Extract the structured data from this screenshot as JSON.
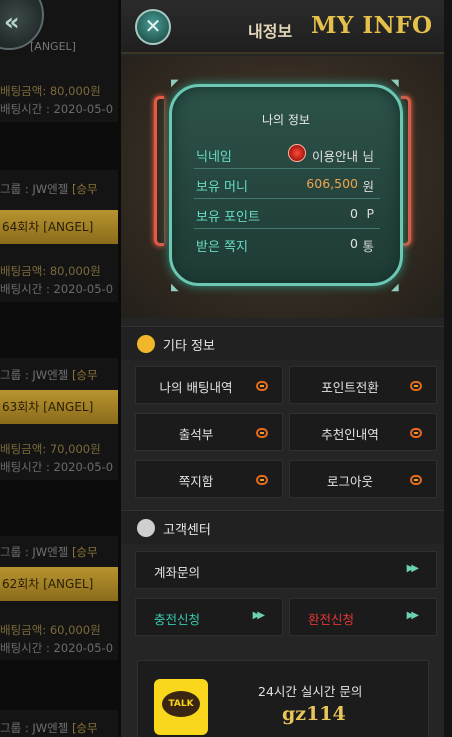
{
  "background_list": {
    "top_text": "[ANGEL]",
    "items": [
      {
        "amount": "배팅금액: 80,000원",
        "time": "배팅시간 : 2020-05-0",
        "team": "그룹 : JW엔젤 ",
        "status": "[승무"
      },
      {
        "round": "64회차 [ANGEL]",
        "amount": "배팅금액: 80,000원",
        "time": "배팅시간 : 2020-05-0",
        "team": "그룹 : JW엔젤 ",
        "status": "[승무"
      },
      {
        "round": "63회차 [ANGEL]",
        "amount": "배팅금액: 70,000원",
        "time": "배팅시간 : 2020-05-0",
        "team": "그룹 : JW엔젤 ",
        "status": "[승무"
      },
      {
        "round": "62회차 [ANGEL]",
        "amount": "배팅금액: 60,000원",
        "time": "배팅시간 : 2020-05-0",
        "team": "그룹 : JW엔젤 ",
        "status": "[승무"
      }
    ]
  },
  "header": {
    "close_icon": "close-x-icon",
    "title_kr": "내정보",
    "title_en": "MY INFO"
  },
  "info": {
    "title": "나의 정보",
    "nickname_label": "닉네임",
    "nickname_value": "이용안내",
    "nickname_suffix": "님",
    "money_label": "보유 머니",
    "money_value": "606,500",
    "money_unit": "원",
    "point_label": "보유 포인트",
    "point_value": "0",
    "point_unit": "P",
    "message_label": "받은 쪽지",
    "message_value": "0",
    "message_unit": "통"
  },
  "etc": {
    "title": "기타 정보",
    "buttons": [
      "나의 배팅내역",
      "포인트전환",
      "출석부",
      "추천인내역",
      "쪽지함",
      "로그아웃"
    ]
  },
  "support": {
    "title": "고객센터",
    "account_inquiry": "계좌문의",
    "charge": "충전신청",
    "exchange": "환전신청",
    "arrow": "▶▶"
  },
  "kakao": {
    "logo_text": "TALK",
    "line1": "24시간 실시간 문의",
    "line2": "gz114"
  },
  "colors": {
    "accent_gold": "#e5c04b",
    "teal": "#66dcc4",
    "money": "#f0a34c",
    "exchange_red": "#e23636"
  }
}
